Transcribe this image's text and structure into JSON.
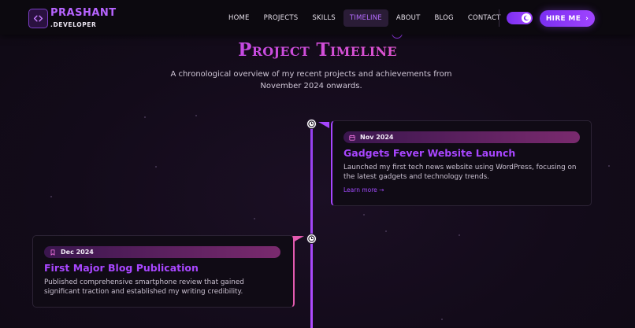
{
  "brand": {
    "name": "PRASHANT",
    "tagline": ".DEVELOPER",
    "logo_icon": "code-brackets-icon"
  },
  "nav": {
    "items": [
      {
        "label": "HOME",
        "active": false
      },
      {
        "label": "PROJECTS",
        "active": false
      },
      {
        "label": "SKILLS",
        "active": false
      },
      {
        "label": "TIMELINE",
        "active": true
      },
      {
        "label": "ABOUT",
        "active": false
      },
      {
        "label": "BLOG",
        "active": false
      },
      {
        "label": "CONTACT",
        "active": false
      }
    ],
    "theme_toggle_icon": "moon-icon",
    "hire_label": "HIRE ME",
    "hire_icon": "chevron-right-icon"
  },
  "page": {
    "title": "Project Timeline",
    "subtitle": "A chronological overview of my recent projects and achievements from November 2024 onwards."
  },
  "timeline": [
    {
      "date": "Nov 2024",
      "date_icon": "calendar-icon",
      "title": "Gadgets Fever Website Launch",
      "description": "Launched my first tech news website using WordPress, focusing on the latest gadgets and technology trends.",
      "link": "Learn more →",
      "node_icon": "clock-icon"
    },
    {
      "date": "Dec 2024",
      "date_icon": "bookmark-icon",
      "title": "First Major Blog Publication",
      "description": "Published comprehensive smartphone review that gained significant traction and established my writing credibility.",
      "node_icon": "clock-icon"
    }
  ],
  "colors": {
    "accent": "#a646ff",
    "accent_pink": "#e35bb0",
    "background": "#130b1a"
  }
}
